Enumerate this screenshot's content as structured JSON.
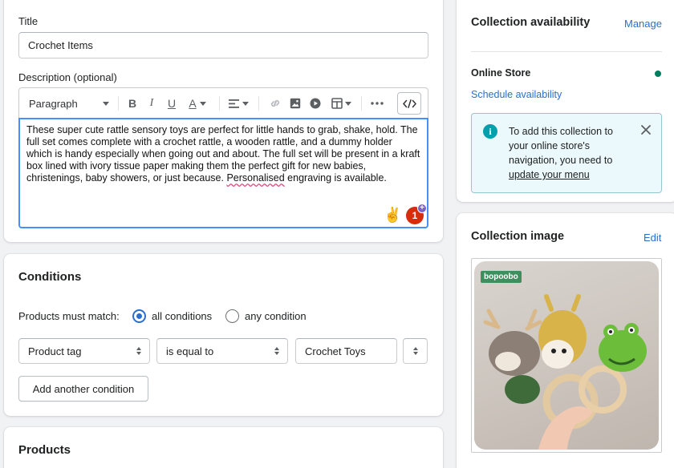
{
  "title_card": {
    "title_label": "Title",
    "title_value": "Crochet Items",
    "description_label": "Description (optional)",
    "toolbar": {
      "format_select": "Paragraph",
      "bold": "B",
      "italic": "I",
      "underline": "U",
      "text_color": "A"
    },
    "description_text_before": "These super cute rattle sensory toys are perfect for little hands to grab, shake, hold. The full set comes complete with a crochet rattle, a wooden rattle, and a dummy holder which is handy especially when going out and about. The full set will be present in a kraft box lined with ivory tissue paper making them the perfect gift for new babies, christenings, baby showers, or just because. ",
    "description_misspelled": "Personalised",
    "description_text_after": " engraving is available.",
    "notification_count": "1"
  },
  "conditions": {
    "heading": "Conditions",
    "match_label": "Products must match:",
    "option_all": "all conditions",
    "option_any": "any condition",
    "selected": "all conditions",
    "field_select": "Product tag",
    "operator_select": "is equal to",
    "value_input": "Crochet Toys",
    "add_button": "Add another condition"
  },
  "products": {
    "heading": "Products"
  },
  "availability": {
    "heading": "Collection availability",
    "manage_link": "Manage",
    "channel_name": "Online Store",
    "channel_status_color": "#007f5f",
    "schedule_link": "Schedule availability",
    "banner_text": "To add this collection to your online store's navigation, you need to",
    "banner_link": "update your menu"
  },
  "collection_image": {
    "heading": "Collection image",
    "edit_link": "Edit",
    "brand_badge": "bopoobo"
  },
  "colors": {
    "accent": "#2c6ecb",
    "focus": "#458fff",
    "banner_icon": "#00a0ac",
    "badge_red": "#d72c0d",
    "brand_green": "#3e8e5e"
  }
}
